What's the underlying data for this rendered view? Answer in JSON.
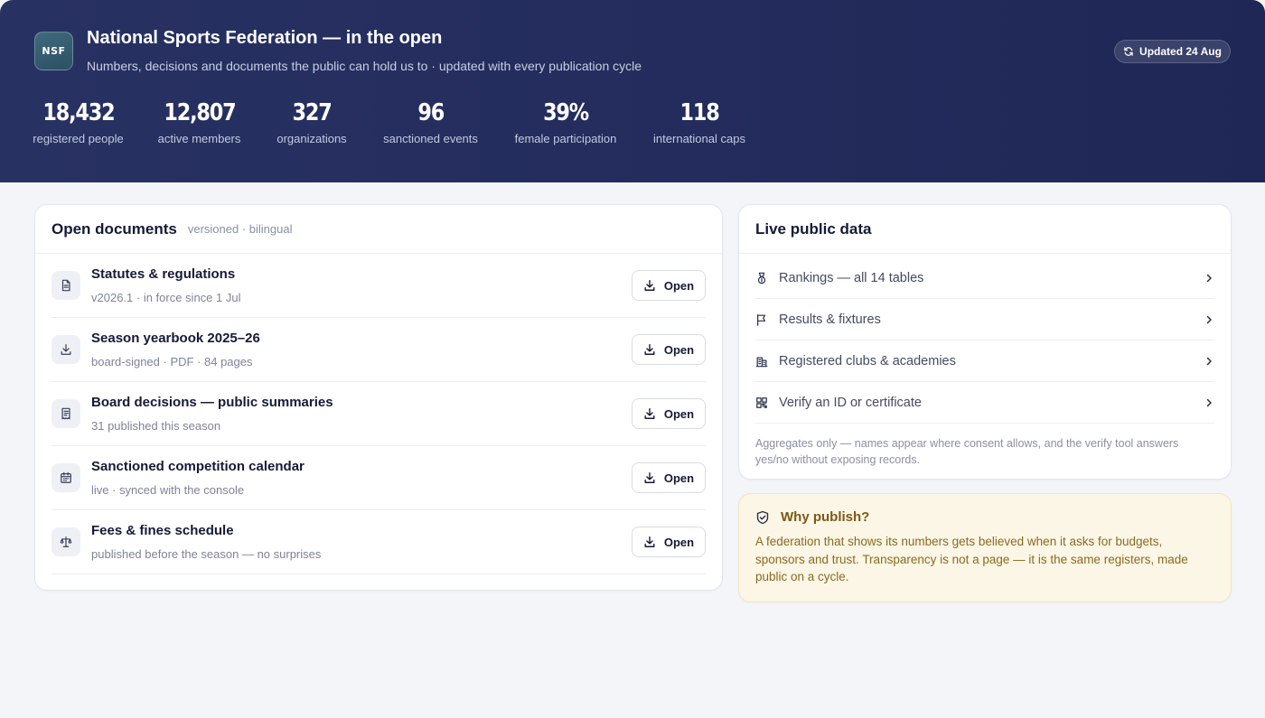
{
  "header": {
    "logo_text": "NSF",
    "title": "National Sports Federation — in the open",
    "subtitle": "Numbers, decisions and documents the public can hold us to · updated with every publication cycle",
    "updated_label": "Updated 24 Aug",
    "stats": [
      {
        "value": "18,432",
        "label": "registered people"
      },
      {
        "value": "12,807",
        "label": "active members"
      },
      {
        "value": "327",
        "label": "organizations"
      },
      {
        "value": "96",
        "label": "sanctioned events"
      },
      {
        "value": "39%",
        "label": "female participation"
      },
      {
        "value": "118",
        "label": "international caps"
      }
    ]
  },
  "documents": {
    "title": "Open documents",
    "subtitle": "versioned · bilingual",
    "open_label": "Open",
    "items": [
      {
        "title": "Statutes & regulations",
        "meta": "v2026.1 · in force since 1 Jul",
        "icon": "document-icon"
      },
      {
        "title": "Season yearbook 2025–26",
        "meta": "board-signed · PDF · 84 pages",
        "icon": "download-icon"
      },
      {
        "title": "Board decisions — public summaries",
        "meta": "31 published this season",
        "icon": "receipt-icon"
      },
      {
        "title": "Sanctioned competition calendar",
        "meta": "live · synced with the console",
        "icon": "calendar-icon"
      },
      {
        "title": "Fees & fines schedule",
        "meta": "published before the season — no surprises",
        "icon": "scales-icon"
      }
    ]
  },
  "live_data": {
    "title": "Live public data",
    "items": [
      {
        "label": "Rankings — all 14 tables",
        "icon": "medal-icon"
      },
      {
        "label": "Results & fixtures",
        "icon": "flag-icon"
      },
      {
        "label": "Registered clubs & academies",
        "icon": "building-icon"
      },
      {
        "label": "Verify an ID or certificate",
        "icon": "qr-code-icon"
      }
    ],
    "note": "Aggregates only — names appear where consent allows, and the verify tool answers yes/no without exposing records."
  },
  "why_publish": {
    "title": "Why publish?",
    "body": "A federation that shows its numbers gets believed when it asks for budgets, sponsors and trust. Transparency is not a page — it is the same registers, made public on a cycle."
  },
  "colors": {
    "header_bg": "#252e5e",
    "page_bg": "#f4f5f9",
    "why_bg": "#fcf6e6",
    "why_text": "#8a6a1f"
  }
}
